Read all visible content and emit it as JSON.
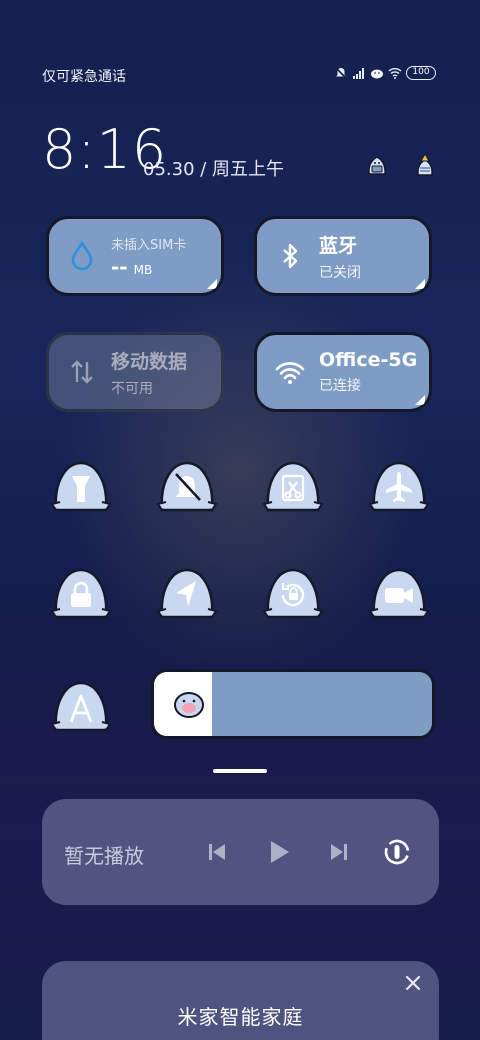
{
  "status_bar": {
    "carrier_text": "仅可紧急通话",
    "battery": "100",
    "icons": [
      "mute-icon",
      "signal-icon",
      "pet-icon",
      "wifi-icon"
    ]
  },
  "header": {
    "time": "8:16",
    "date": "05.30 / 周五上午",
    "icons": [
      "edit-icon",
      "settings-icon"
    ]
  },
  "tiles": {
    "data_usage": {
      "title": "未插入SIM卡",
      "value": "--",
      "unit": "MB",
      "icon": "water-drop-icon",
      "active": true
    },
    "bluetooth": {
      "title": "蓝牙",
      "sub": "已关闭",
      "icon": "bluetooth-icon",
      "active": true
    },
    "mobile_data": {
      "title": "移动数据",
      "sub": "不可用",
      "icon": "mobile-data-icon",
      "active": false
    },
    "wifi": {
      "title": "Office-5G",
      "sub": "已连接",
      "icon": "wifi-icon",
      "active": true
    }
  },
  "toggles": [
    {
      "name": "flashlight",
      "icon": "flashlight-icon"
    },
    {
      "name": "mute",
      "icon": "bell-off-icon"
    },
    {
      "name": "screenshot",
      "icon": "scissors-icon"
    },
    {
      "name": "airplane-mode",
      "icon": "airplane-icon"
    },
    {
      "name": "lock-screen",
      "icon": "lock-icon"
    },
    {
      "name": "location",
      "icon": "location-arrow-icon"
    },
    {
      "name": "rotation-lock",
      "icon": "rotate-lock-icon"
    },
    {
      "name": "screen-recorder",
      "icon": "video-camera-icon"
    },
    {
      "name": "auto-brightness",
      "icon": "letter-a-icon"
    }
  ],
  "brightness": {
    "level": 0.21
  },
  "media": {
    "status": "暂无播放",
    "controls": [
      "previous-icon",
      "play-icon",
      "next-icon",
      "cast-icon"
    ]
  },
  "smart_home": {
    "title": "米家智能家庭"
  },
  "colors": {
    "tile_active": "#7e9cc4",
    "whale_body": "#c9d8f0",
    "outline": "#15182a"
  }
}
